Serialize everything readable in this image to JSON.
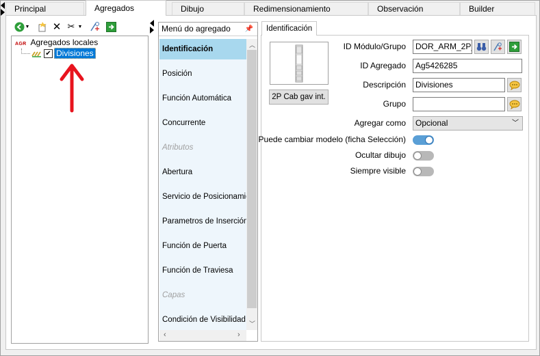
{
  "tabs": [
    "Principal",
    "Agregados",
    "Dibujo",
    "Redimensionamiento",
    "Observación",
    "Builder"
  ],
  "active_tab": "Agregados",
  "tree": {
    "root_badge": "AGR",
    "root_label": "Agregados locales",
    "child_label": "Divisiones",
    "child_checked": true
  },
  "menu": {
    "header": "Menú do agregado",
    "items": [
      {
        "label": "Identificación",
        "state": "active"
      },
      {
        "label": "Posición",
        "state": "normal"
      },
      {
        "label": "Función Automática",
        "state": "normal"
      },
      {
        "label": "Concurrente",
        "state": "normal"
      },
      {
        "label": "Atributos",
        "state": "disabled"
      },
      {
        "label": "Abertura",
        "state": "normal"
      },
      {
        "label": "Servicio de Posicionamiento",
        "state": "normal"
      },
      {
        "label": "Parametros de Inserción",
        "state": "normal"
      },
      {
        "label": "Función de Puerta",
        "state": "normal"
      },
      {
        "label": "Función de Traviesa",
        "state": "normal"
      },
      {
        "label": "Capas",
        "state": "disabled"
      },
      {
        "label": "Condición de Visibilidad",
        "state": "normal"
      }
    ]
  },
  "detail": {
    "tab": "Identificación",
    "preview_button": "2P Cab gav int.",
    "fields": {
      "id_modulo_label": "ID Módulo/Grupo",
      "id_modulo_value": "DOR_ARM_2P_",
      "id_agregado_label": "ID Agregado",
      "id_agregado_value": "Ag5426285",
      "descripcion_label": "Descripción",
      "descripcion_value": "Divisiones",
      "grupo_label": "Grupo",
      "grupo_value": ""
    },
    "agregar_como_label": "Agregar como",
    "agregar_como_value": "Opcional",
    "toggles": [
      {
        "label": "Puede cambiar modelo (ficha Selección)",
        "on": true
      },
      {
        "label": "Ocultar dibujo",
        "on": false
      },
      {
        "label": "Siempre visible",
        "on": false
      }
    ]
  },
  "colors": {
    "accent": "#0078d7",
    "menu_active": "#a8d8ee",
    "annotation": "#e8141e"
  }
}
